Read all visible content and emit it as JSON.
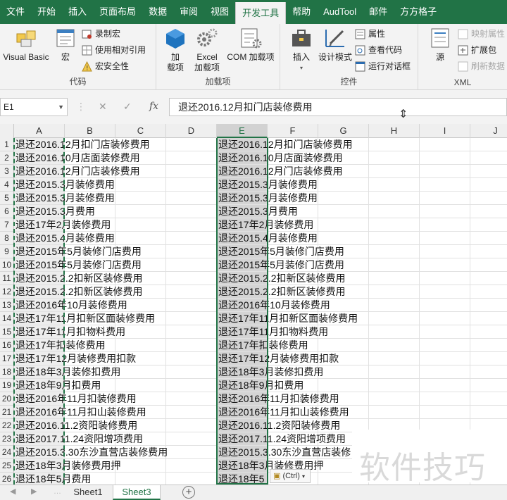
{
  "tabs": [
    "文件",
    "开始",
    "插入",
    "页面布局",
    "数据",
    "审阅",
    "视图",
    "开发工具",
    "帮助",
    "AudTool",
    "邮件",
    "方方格子"
  ],
  "active_tab": "开发工具",
  "ribbon": {
    "code": {
      "label": "代码",
      "visual_basic": "Visual Basic",
      "macros": "宏",
      "record_macro": "录制宏",
      "relative_refs": "使用相对引用",
      "macro_security": "宏安全性"
    },
    "addins": {
      "label": "加载项",
      "addins_line1": "加",
      "addins_line2": "载项",
      "excel_addins_line1": "Excel",
      "excel_addins_line2": "加载项",
      "com_addins": "COM 加载项"
    },
    "controls": {
      "label": "控件",
      "insert": "插入",
      "design_mode": "设计模式",
      "properties": "属性",
      "view_code": "查看代码",
      "run_dialog": "运行对话框"
    },
    "xml": {
      "label": "XML",
      "source": "源",
      "map_properties": "映射属性",
      "expansion_packs": "扩展包",
      "refresh_data": "刷新数据"
    }
  },
  "formula_bar": {
    "name_box": "E1",
    "formula": "退还2016.12月扣门店装修费用",
    "cancel_glyph": "✕",
    "enter_glyph": "✓",
    "fx_glyph": "fx"
  },
  "columns": [
    "A",
    "B",
    "C",
    "D",
    "E",
    "F",
    "G",
    "H",
    "I",
    "J"
  ],
  "selected_column": "E",
  "rows": [
    {
      "n": "1",
      "text": "退还2016.12月扣门店装修费用"
    },
    {
      "n": "2",
      "text": "退还2016.10月店面装修费用"
    },
    {
      "n": "3",
      "text": "退还2016.12月门店装修费用"
    },
    {
      "n": "4",
      "text": "退还2015.3月装修费用"
    },
    {
      "n": "5",
      "text": "退还2015.3月装修费用"
    },
    {
      "n": "6",
      "text": "退还2015.3月费用"
    },
    {
      "n": "7",
      "text": "退还17年2月装修费用"
    },
    {
      "n": "8",
      "text": "退还2015.4月装修费用"
    },
    {
      "n": "9",
      "text": "退还2015年5月装修门店费用"
    },
    {
      "n": "10",
      "text": "退还2015年5月装修门店费用"
    },
    {
      "n": "11",
      "text": "退还2015.2.2扣新区装修费用"
    },
    {
      "n": "12",
      "text": "退还2015.2.2扣新区装修费用"
    },
    {
      "n": "13",
      "text": "退还2016年10月装修费用"
    },
    {
      "n": "14",
      "text": "退还17年11月扣新区面装修费用"
    },
    {
      "n": "15",
      "text": "退还17年11月扣物料费用"
    },
    {
      "n": "16",
      "text": "退还17年扣装修费用"
    },
    {
      "n": "17",
      "text": "退还17年12月装修费用扣款"
    },
    {
      "n": "18",
      "text": "退还18年3月装修扣费用"
    },
    {
      "n": "19",
      "text": "退还18年9月扣费用"
    },
    {
      "n": "20",
      "text": "退还2016年11月扣装修费用"
    },
    {
      "n": "21",
      "text": "退还2016年11月扣山装修费用"
    },
    {
      "n": "22",
      "text": "退还2016.11.2资阳装修费用"
    },
    {
      "n": "23",
      "text": "退还2017.11.24资阳增项费用"
    },
    {
      "n": "24",
      "text": "退还2015.3.30东沙直营店装修费用"
    },
    {
      "n": "25",
      "text": "退还18年3月装修费用押"
    },
    {
      "n": "26",
      "text": "退还18年5月费用"
    }
  ],
  "col_e_rows": [
    "退还2016.12月扣门店装修费用",
    "退还2016.10月店面装修费用",
    "退还2016.12月门店装修费用",
    "退还2015.3月装修费用",
    "退还2015.3月装修费用",
    "退还2015.3月费用",
    "退还17年2月装修费用",
    "退还2015.4月装修费用",
    "退还2015年5月装修门店费用",
    "退还2015年5月装修门店费用",
    "退还2015.2.2扣新区装修费用",
    "退还2015.2.2扣新区装修费用",
    "退还2016年10月装修费用",
    "退还17年11月扣新区面装修费用",
    "退还17年11月扣物料费用",
    "退还17年扣装修费用",
    "退还17年12月装修费用扣款",
    "退还18年3月装修扣费用",
    "退还18年9月扣费用",
    "退还2016年11月扣装修费用",
    "退还2016年11月扣山装修费用",
    "退还2016.11.2资阳装修费用",
    "退还2017.11.24资阳增项费用",
    "退还2015.3.30东沙直营店装修",
    "退还18年3月装修费用押",
    "退还18年5"
  ],
  "paste_options": "(Ctrl)",
  "watermark": "软件技巧",
  "sheets": [
    "Sheet1",
    "Sheet3"
  ],
  "active_sheet": "Sheet3",
  "colors": {
    "excel_green": "#217346"
  }
}
